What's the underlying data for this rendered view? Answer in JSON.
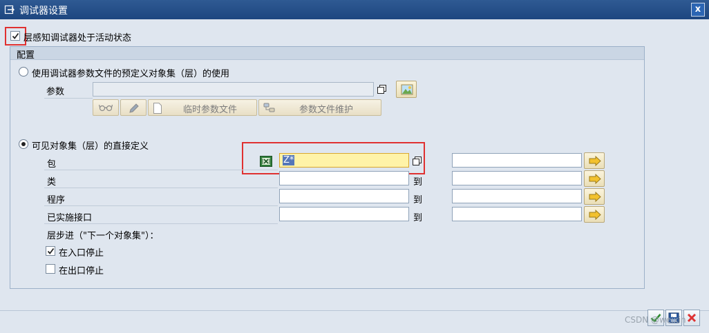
{
  "window": {
    "title": "调试器设置",
    "close_label": "x"
  },
  "layer_aware": {
    "label": "层感知调试器处于活动状态",
    "checked": true
  },
  "config": {
    "title": "配置",
    "profile_option": {
      "label": "使用调试器参数文件的预定义对象集（层）的使用",
      "selected": false,
      "param_label": "参数",
      "param_value": "",
      "temp_button": "临时参数文件",
      "maint_button": "参数文件维护"
    },
    "direct_option": {
      "label": "可见对象集（层）的直接定义",
      "selected": true,
      "to_label": "到",
      "rows": [
        {
          "label": "包",
          "from": "Z*",
          "to": ""
        },
        {
          "label": "类",
          "from": "",
          "to": ""
        },
        {
          "label": "程序",
          "from": "",
          "to": ""
        },
        {
          "label": "已实施接口",
          "from": "",
          "to": ""
        }
      ]
    },
    "step": {
      "label": "层步进（\"下一个对象集\"）：",
      "stop_at_entry": {
        "label": "在入口停止",
        "checked": true
      },
      "stop_at_exit": {
        "label": "在出口停止",
        "checked": false
      }
    }
  },
  "watermark": "CSDN @weixin"
}
